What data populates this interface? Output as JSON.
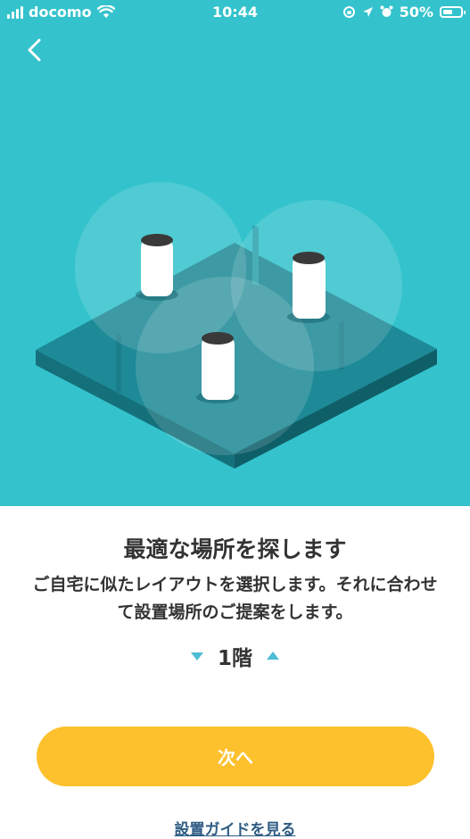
{
  "status_bar": {
    "carrier": "docomo",
    "time": "10:44",
    "battery": "50%",
    "icons": [
      "signal-icon",
      "wifi-icon",
      "orientation-lock-icon",
      "location-icon",
      "alarm-icon",
      "battery-icon"
    ]
  },
  "colors": {
    "hero_background": "#34c3cc",
    "primary_button": "#fdc12d",
    "link": "#2f5c84",
    "arrow": "#4dbdd6"
  },
  "main": {
    "title": "最適な場所を探します",
    "description": "ご自宅に似たレイアウトを選択します。それに合わせて設置場所のご提案をします。",
    "floor_label": "1階",
    "next_button": "次へ",
    "guide_link": "設置ガイドを見る"
  }
}
